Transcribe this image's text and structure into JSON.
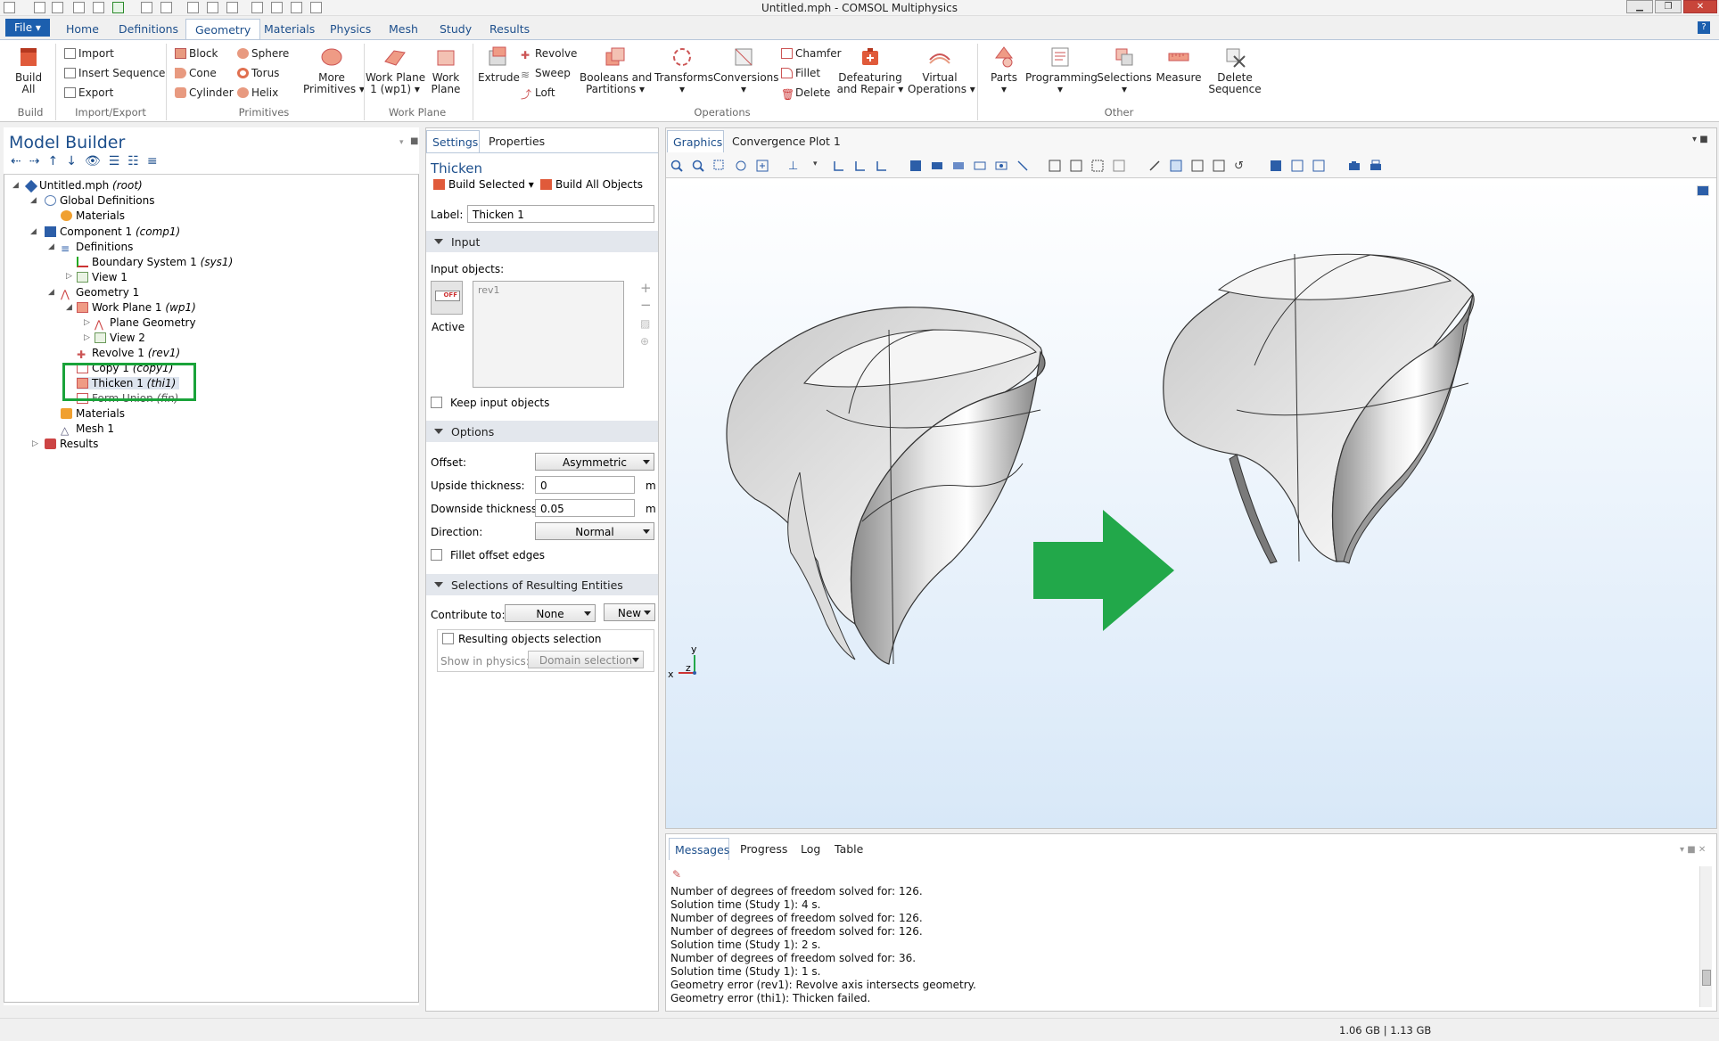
{
  "window": {
    "title": "Untitled.mph - COMSOL Multiphysics"
  },
  "ribbon_tabs": [
    "File ▾",
    "Home",
    "Definitions",
    "Geometry",
    "Materials",
    "Physics",
    "Mesh",
    "Study",
    "Results"
  ],
  "ribbon": {
    "build_all": "Build\nAll",
    "build_group": "Build",
    "import": "Import",
    "insert_sequence": "Insert Sequence",
    "export": "Export",
    "import_export_group": "Import/Export",
    "block": "Block",
    "cone": "Cone",
    "cylinder": "Cylinder",
    "sphere": "Sphere",
    "torus": "Torus",
    "helix": "Helix",
    "more_primitives": "More\nPrimitives ▾",
    "primitives_group": "Primitives",
    "work_plane_1": "Work Plane\n1 (wp1) ▾",
    "work_plane": "Work\nPlane",
    "work_plane_group": "Work Plane",
    "extrude": "Extrude",
    "revolve": "Revolve",
    "sweep": "Sweep",
    "loft": "Loft",
    "booleans": "Booleans and\nPartitions ▾",
    "transforms": "Transforms\n▾",
    "conversions": "Conversions\n▾",
    "chamfer": "Chamfer",
    "fillet": "Fillet",
    "delete": "Delete",
    "operations_group": "Operations",
    "defeaturing": "Defeaturing\nand Repair ▾",
    "virtual_ops": "Virtual\nOperations ▾",
    "parts": "Parts\n▾",
    "programming": "Programming\n▾",
    "selections": "Selections\n▾",
    "measure": "Measure",
    "delete_sequence": "Delete\nSequence",
    "other_group": "Other"
  },
  "model_builder": {
    "title": "Model Builder",
    "tree": [
      {
        "label": "Untitled.mph",
        "tag": "(root)"
      },
      {
        "label": "Global Definitions",
        "tag": ""
      },
      {
        "label": "Materials",
        "tag": ""
      },
      {
        "label": "Component 1",
        "tag": "(comp1)"
      },
      {
        "label": "Definitions",
        "tag": ""
      },
      {
        "label": "Boundary System 1",
        "tag": "(sys1)"
      },
      {
        "label": "View 1",
        "tag": ""
      },
      {
        "label": "Geometry 1",
        "tag": ""
      },
      {
        "label": "Work Plane 1",
        "tag": "(wp1)"
      },
      {
        "label": "Plane Geometry",
        "tag": ""
      },
      {
        "label": "View 2",
        "tag": ""
      },
      {
        "label": "Revolve 1",
        "tag": "(rev1)"
      },
      {
        "label": "Copy 1",
        "tag": "(copy1)"
      },
      {
        "label": "Thicken 1",
        "tag": "(thi1)"
      },
      {
        "label": "Form Union",
        "tag": "(fin)"
      },
      {
        "label": "Materials",
        "tag": ""
      },
      {
        "label": "Mesh 1",
        "tag": ""
      },
      {
        "label": "Results",
        "tag": ""
      }
    ]
  },
  "settings": {
    "tabs": [
      "Settings",
      "Properties"
    ],
    "heading": "Thicken",
    "build_selected": "Build Selected",
    "build_all_objects": "Build All Objects",
    "label_caption": "Label:",
    "label_value": "Thicken 1",
    "input_section": "Input",
    "input_objects_caption": "Input objects:",
    "input_objects": [
      "rev1"
    ],
    "active_toggle": "OFF",
    "active_label": "Active",
    "keep_input": "Keep input objects",
    "options_section": "Options",
    "offset_caption": "Offset:",
    "offset_value": "Asymmetric",
    "upside_caption": "Upside thickness:",
    "upside_value": "0",
    "upside_unit": "m",
    "downside_caption": "Downside thickness:",
    "downside_value": "0.05",
    "downside_unit": "m",
    "direction_caption": "Direction:",
    "direction_value": "Normal",
    "fillet_offset": "Fillet offset edges",
    "selections_section": "Selections of Resulting Entities",
    "contribute_caption": "Contribute to:",
    "contribute_value": "None",
    "new_button": "New",
    "resulting_selection": "Resulting objects selection",
    "show_in_physics_caption": "Show in physics:",
    "show_in_physics_value": "Domain selection"
  },
  "graphics": {
    "tabs": [
      "Graphics",
      "Convergence Plot 1"
    ],
    "axes": {
      "x": "x",
      "y": "y",
      "z": "z"
    },
    "arrow_color": "#22a84a"
  },
  "messages": {
    "tabs": [
      "Messages",
      "Progress",
      "Log",
      "Table"
    ],
    "lines": [
      "Number of degrees of freedom solved for: 126.",
      "Solution time (Study 1): 4 s.",
      "Number of degrees of freedom solved for: 126.",
      "Number of degrees of freedom solved for: 126.",
      "Solution time (Study 1): 2 s.",
      "Number of degrees of freedom solved for: 36.",
      "Solution time (Study 1): 1 s.",
      "Geometry error (rev1): Revolve axis intersects geometry.",
      "Geometry error (thi1): Thicken failed."
    ]
  },
  "status": {
    "memory": "1.06 GB | 1.13 GB"
  },
  "colors": {
    "accent": "#1c5fae",
    "highlight_box": "#1aa33a",
    "graphics_bg_top": "#ffffff",
    "graphics_bg_bottom": "#d8e8f8"
  }
}
